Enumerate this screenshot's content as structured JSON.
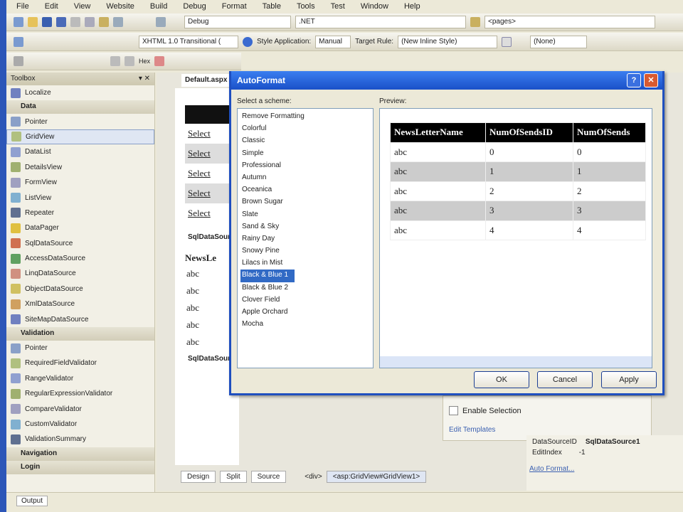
{
  "menu": [
    "File",
    "Edit",
    "View",
    "Website",
    "Build",
    "Debug",
    "Format",
    "Table",
    "Tools",
    "Test",
    "Window",
    "Help"
  ],
  "toolbar1": {
    "config": "Debug",
    "platform": ".NET",
    "find": "<pages>"
  },
  "toolbar2": {
    "doctype": "XHTML 1.0 Transitional (",
    "style_app_label": "Style Application:",
    "style_app": "Manual",
    "target_rule_label": "Target Rule:",
    "target_rule": "(New Inline Style)",
    "font": "(None)"
  },
  "toolbar3": {
    "font_size": "Hex"
  },
  "toolbox": {
    "title": "Toolbox",
    "items": [
      {
        "type": "item",
        "label": "Localize"
      },
      {
        "type": "cat",
        "label": "Data"
      },
      {
        "type": "item",
        "label": "Pointer"
      },
      {
        "type": "item",
        "label": "GridView",
        "selected": true
      },
      {
        "type": "item",
        "label": "DataList"
      },
      {
        "type": "item",
        "label": "DetailsView"
      },
      {
        "type": "item",
        "label": "FormView"
      },
      {
        "type": "item",
        "label": "ListView"
      },
      {
        "type": "item",
        "label": "Repeater"
      },
      {
        "type": "item",
        "label": "DataPager"
      },
      {
        "type": "item",
        "label": "SqlDataSource"
      },
      {
        "type": "item",
        "label": "AccessDataSource"
      },
      {
        "type": "item",
        "label": "LinqDataSource"
      },
      {
        "type": "item",
        "label": "ObjectDataSource"
      },
      {
        "type": "item",
        "label": "XmlDataSource"
      },
      {
        "type": "item",
        "label": "SiteMapDataSource"
      },
      {
        "type": "cat",
        "label": "Validation"
      },
      {
        "type": "item",
        "label": "Pointer"
      },
      {
        "type": "item",
        "label": "RequiredFieldValidator"
      },
      {
        "type": "item",
        "label": "RangeValidator"
      },
      {
        "type": "item",
        "label": "RegularExpressionValidator"
      },
      {
        "type": "item",
        "label": "CompareValidator"
      },
      {
        "type": "item",
        "label": "CustomValidator"
      },
      {
        "type": "item",
        "label": "ValidationSummary"
      },
      {
        "type": "cat",
        "label": "Navigation"
      },
      {
        "type": "cat",
        "label": "Login"
      }
    ],
    "output_tab": "Output"
  },
  "document": {
    "tab": "Default.aspx",
    "select_links": [
      "Select",
      "Select",
      "Select",
      "Select",
      "Select"
    ],
    "sqlds1": "SqlDataSource",
    "grid_header": "NewsLe",
    "grid_cells": [
      "abc",
      "abc",
      "abc",
      "abc",
      "abc"
    ],
    "sqlds2": "SqlDataSource"
  },
  "dialog": {
    "title": "AutoFormat",
    "help": "?",
    "close": "✕",
    "scheme_label": "Select a scheme:",
    "preview_label": "Preview:",
    "schemes": [
      "Remove Formatting",
      "Colorful",
      "Classic",
      "Simple",
      "Professional",
      "Autumn",
      "Oceanica",
      "Brown Sugar",
      "Slate",
      "Sand & Sky",
      "Rainy Day",
      "Snowy Pine",
      "Lilacs in Mist",
      "Black & Blue 1",
      "Black & Blue 2",
      "Clover Field",
      "Apple Orchard",
      "Mocha"
    ],
    "selected_index": 13,
    "preview": {
      "headers": [
        "NewsLetterName",
        "NumOfSendsID",
        "NumOfSends"
      ],
      "rows": [
        [
          "abc",
          "0",
          "0"
        ],
        [
          "abc",
          "1",
          "1"
        ],
        [
          "abc",
          "2",
          "2"
        ],
        [
          "abc",
          "3",
          "3"
        ],
        [
          "abc",
          "4",
          "4"
        ]
      ]
    },
    "ok": "OK",
    "cancel": "Cancel",
    "apply": "Apply"
  },
  "smart_tag": {
    "enable_selection": "Enable Selection",
    "edit_templates": "Edit Templates"
  },
  "properties": {
    "rows": [
      [
        "DataSourceID",
        "SqlDataSource1"
      ],
      [
        "EditIndex",
        "-1"
      ]
    ],
    "auto_format_link": "Auto Format..."
  },
  "view_tabs": {
    "design": "Design",
    "split": "Split",
    "source": "Source",
    "crumb1": "<div>",
    "crumb2": "<asp:GridView#GridView1>"
  }
}
